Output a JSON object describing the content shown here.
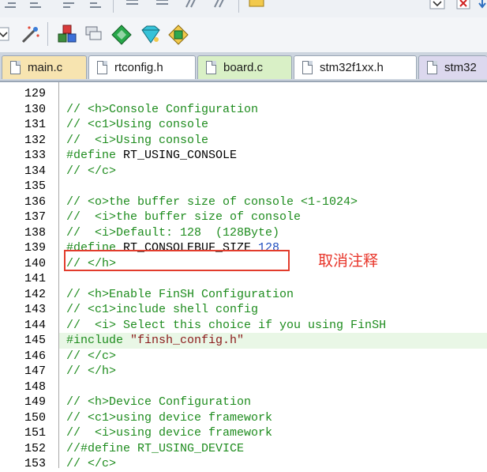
{
  "tabs": [
    {
      "label": "main.c",
      "color": "#f7e4b0",
      "active": false
    },
    {
      "label": "rtconfig.h",
      "color": "#ffffff",
      "active": false
    },
    {
      "label": "board.c",
      "color": "#d9f0c6",
      "active": true
    },
    {
      "label": "stm32f1xx.h",
      "color": "#ffffff",
      "active": false
    },
    {
      "label": "stm32",
      "color": "#dcd8ee",
      "active": false
    }
  ],
  "lines": [
    {
      "n": "129",
      "segs": []
    },
    {
      "n": "130",
      "segs": [
        {
          "t": "// <h>Console Configuration",
          "c": "comment"
        }
      ]
    },
    {
      "n": "131",
      "segs": [
        {
          "t": "// <c1>Using console",
          "c": "comment"
        }
      ]
    },
    {
      "n": "132",
      "segs": [
        {
          "t": "//  <i>Using console",
          "c": "comment"
        }
      ]
    },
    {
      "n": "133",
      "segs": [
        {
          "t": "#define",
          "c": "define"
        },
        {
          "t": " RT_USING_CONSOLE",
          "c": "black"
        }
      ]
    },
    {
      "n": "134",
      "segs": [
        {
          "t": "// </c>",
          "c": "comment"
        }
      ]
    },
    {
      "n": "135",
      "segs": []
    },
    {
      "n": "136",
      "segs": [
        {
          "t": "// <o>the buffer size of console <1-1024>",
          "c": "comment"
        }
      ]
    },
    {
      "n": "137",
      "segs": [
        {
          "t": "//  <i>the buffer size of console",
          "c": "comment"
        }
      ]
    },
    {
      "n": "138",
      "segs": [
        {
          "t": "//  <i>Default: 128  (128Byte)",
          "c": "comment"
        }
      ]
    },
    {
      "n": "139",
      "segs": [
        {
          "t": "#define",
          "c": "define"
        },
        {
          "t": " RT_CONSOLEBUF_SIZE ",
          "c": "black"
        },
        {
          "t": "128",
          "c": "num"
        }
      ]
    },
    {
      "n": "140",
      "segs": [
        {
          "t": "// </h>",
          "c": "comment"
        }
      ]
    },
    {
      "n": "141",
      "segs": []
    },
    {
      "n": "142",
      "segs": [
        {
          "t": "// <h>Enable FinSH Configuration",
          "c": "comment"
        }
      ]
    },
    {
      "n": "143",
      "segs": [
        {
          "t": "// <c1>include shell config",
          "c": "comment"
        }
      ]
    },
    {
      "n": "144",
      "segs": [
        {
          "t": "//  <i> Select this choice if you using FinSH",
          "c": "comment"
        }
      ]
    },
    {
      "n": "145",
      "segs": [
        {
          "t": "#include",
          "c": "define"
        },
        {
          "t": " \"finsh_config.h\"",
          "c": "str"
        }
      ],
      "current": true
    },
    {
      "n": "146",
      "segs": [
        {
          "t": "// </c>",
          "c": "comment"
        }
      ]
    },
    {
      "n": "147",
      "segs": [
        {
          "t": "// </h>",
          "c": "comment"
        }
      ]
    },
    {
      "n": "148",
      "segs": []
    },
    {
      "n": "149",
      "segs": [
        {
          "t": "// <h>Device Configuration",
          "c": "comment"
        }
      ]
    },
    {
      "n": "150",
      "segs": [
        {
          "t": "// <c1>using device framework",
          "c": "comment"
        }
      ]
    },
    {
      "n": "151",
      "segs": [
        {
          "t": "//  <i>using device framework",
          "c": "comment"
        }
      ]
    },
    {
      "n": "152",
      "segs": [
        {
          "t": "//#define RT_USING_DEVICE",
          "c": "comment"
        }
      ]
    },
    {
      "n": "153",
      "segs": [
        {
          "t": "// </c>",
          "c": "comment"
        }
      ]
    }
  ],
  "annotation": "取消注释",
  "colors": {
    "annotation": "#e8352a",
    "comment": "#1e8c1e",
    "number": "#1f4fbf",
    "current_line": "#e9f7e6"
  }
}
